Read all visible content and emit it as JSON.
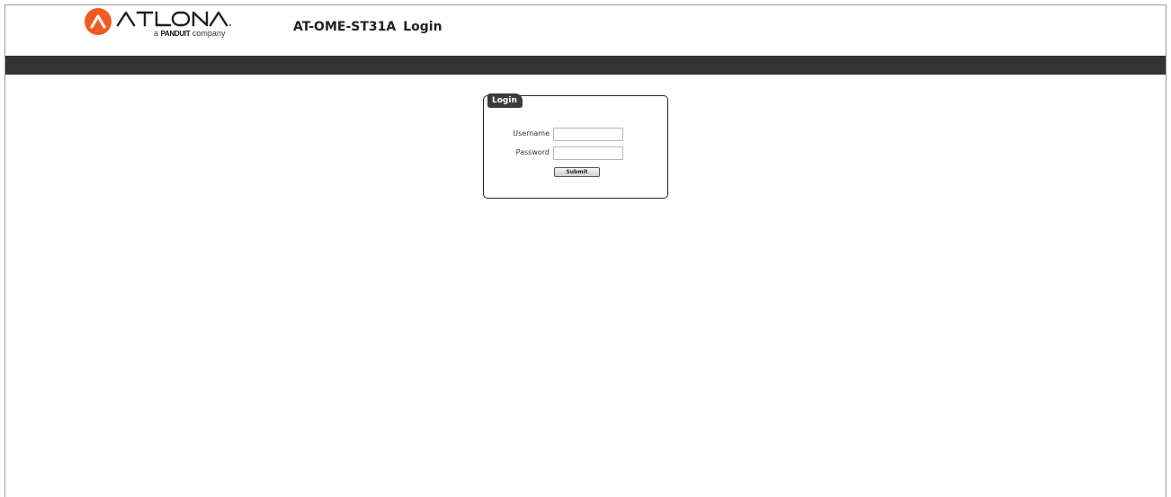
{
  "brand": {
    "logo_word": "ATLONA",
    "logo_sub_prefix": "a",
    "logo_sub_brand": "PANDUIT",
    "logo_sub_suffix": "company",
    "accent_color": "#f15a22"
  },
  "header": {
    "model": "AT-OME-ST31A",
    "title": "Login"
  },
  "nav_bar": {
    "color": "#333333"
  },
  "login": {
    "legend": "Login",
    "username_label": "Username",
    "username_value": "",
    "password_label": "Password",
    "password_value": "",
    "submit_label": "Submit"
  }
}
